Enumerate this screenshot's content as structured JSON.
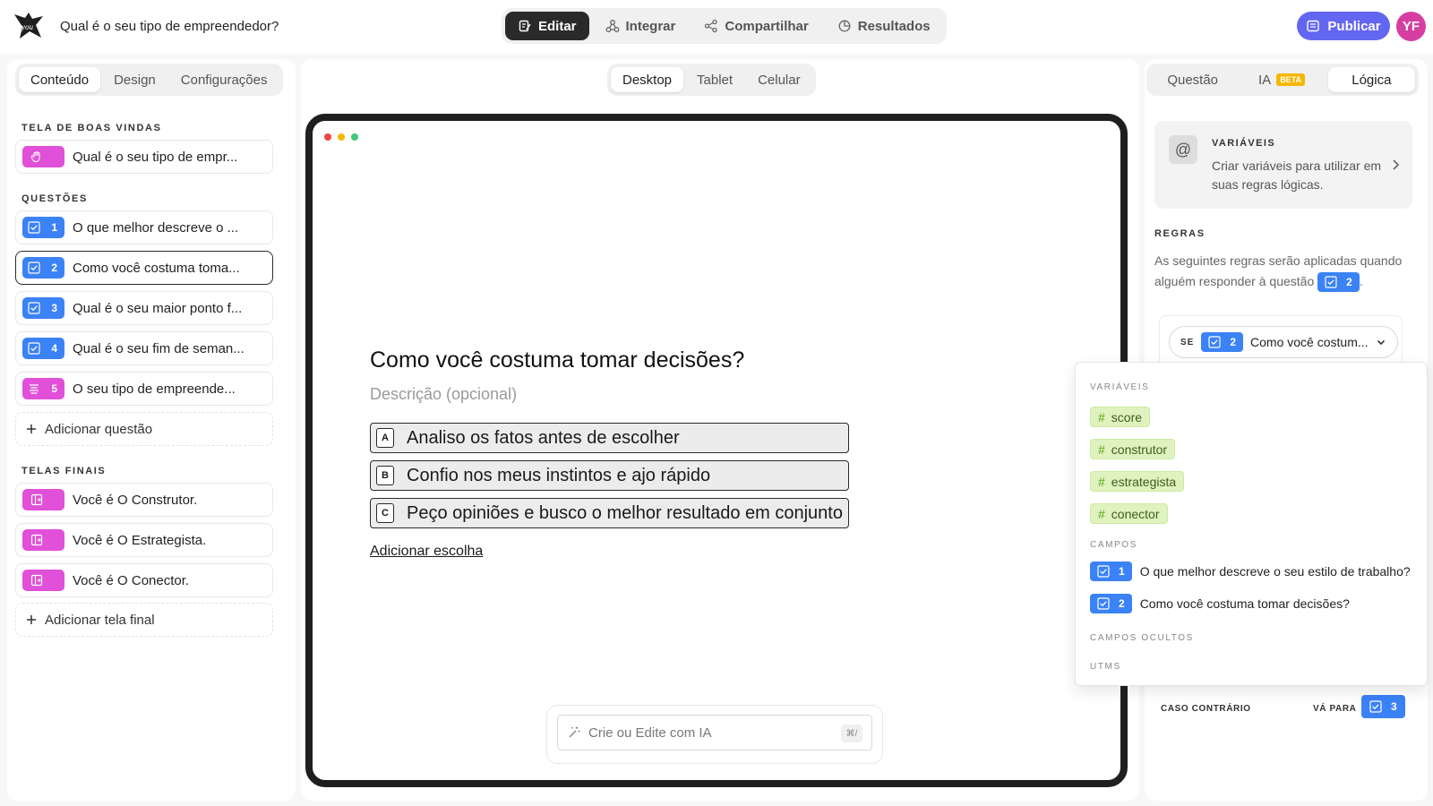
{
  "header": {
    "form_title": "Qual é o seu tipo de empreendedor?",
    "modes": [
      {
        "label": "Editar",
        "icon": "edit-icon",
        "active": true
      },
      {
        "label": "Integrar",
        "icon": "integrate-icon",
        "active": false
      },
      {
        "label": "Compartilhar",
        "icon": "share-icon",
        "active": false
      },
      {
        "label": "Resultados",
        "icon": "results-icon",
        "active": false
      }
    ],
    "publish_label": "Publicar",
    "avatar_initials": "YF",
    "accent_color": "#6366f1",
    "avatar_color": "#d63ea1"
  },
  "left": {
    "tabs": [
      "Conteúdo",
      "Design",
      "Configurações"
    ],
    "welcome_section": "TELA DE BOAS VINDAS",
    "welcome_item": "Qual é o seu tipo de empr...",
    "questions_section": "QUESTÕES",
    "questions": [
      {
        "num": "1",
        "label": "O que melhor descreve o ...",
        "type": "checkbox"
      },
      {
        "num": "2",
        "label": "Como você costuma toma...",
        "type": "checkbox",
        "selected": true
      },
      {
        "num": "3",
        "label": "Qual é o seu maior ponto f...",
        "type": "checkbox"
      },
      {
        "num": "4",
        "label": "Qual é o seu fim de seman...",
        "type": "checkbox"
      },
      {
        "num": "5",
        "label": "O seu tipo de empreende...",
        "type": "text"
      }
    ],
    "add_question": "Adicionar questão",
    "endings_section": "TELAS FINAIS",
    "endings": [
      "Você é O Construtor.",
      "Você é O Estrategista.",
      "Você é O Conector."
    ],
    "add_ending": "Adicionar tela final"
  },
  "center": {
    "devices": [
      "Desktop",
      "Tablet",
      "Celular"
    ],
    "question_title": "Como você costuma tomar decisões?",
    "description_placeholder": "Descrição (opcional)",
    "choices": [
      {
        "key": "A",
        "label": "Analiso os fatos antes de escolher"
      },
      {
        "key": "B",
        "label": "Confio nos meus instintos e ajo rápido"
      },
      {
        "key": "C",
        "label": "Peço opiniões e busco o melhor resultado em conjunto"
      }
    ],
    "add_choice": "Adicionar escolha",
    "ai_placeholder": "Crie ou Edite com IA",
    "ai_shortcut": "⌘/"
  },
  "right": {
    "tabs": [
      "Questão",
      "IA",
      "Lógica"
    ],
    "ia_badge": "BETA",
    "variables_title": "VARIÁVEIS",
    "variables_desc": "Criar variáveis para utilizar em suas regras lógicas.",
    "rules_title": "REGRAS",
    "rules_desc": "As seguintes regras serão aplicadas quando alguém responder à questão",
    "rules_desc_end": ".",
    "rules_question_num": "2",
    "if_label": "SE",
    "if_num": "2",
    "if_value": "Como você costum...",
    "otherwise_label": "CASO CONTRÁRIO",
    "goto_label": "VÁ PARA",
    "goto_num": "3"
  },
  "dropdown": {
    "variables_section": "VARIÁVEIS",
    "variables": [
      "score",
      "construtor",
      "estrategista",
      "conector"
    ],
    "fields_section": "CAMPOS",
    "fields": [
      {
        "num": "1",
        "label": "O que melhor descreve o seu estilo de trabalho?"
      },
      {
        "num": "2",
        "label": "Como você costuma tomar decisões?"
      }
    ],
    "hidden_section": "CAMPOS OCULTOS",
    "utms_section": "UTMS"
  }
}
